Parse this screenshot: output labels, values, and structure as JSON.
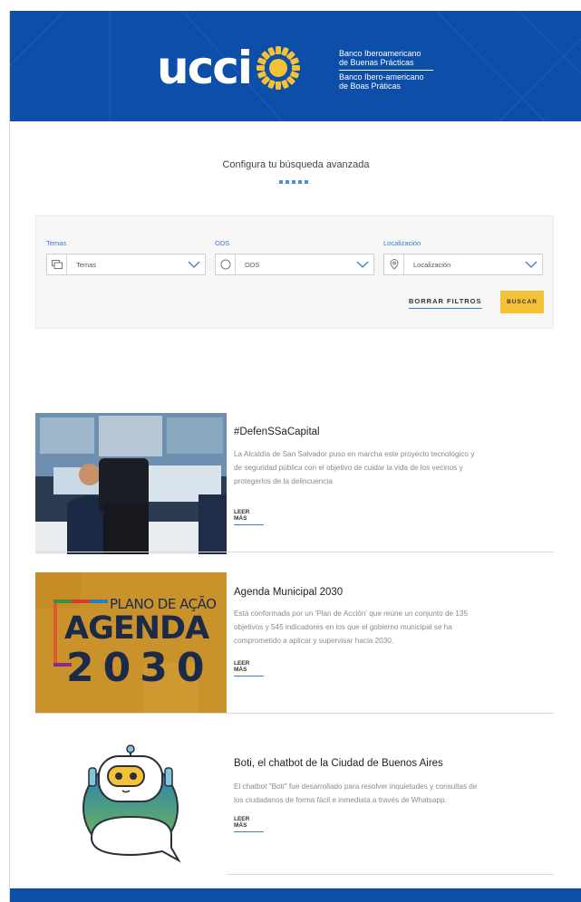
{
  "header": {
    "logo_word": "ucci",
    "tagline_es_1": "Banco Iberoamericano",
    "tagline_es_2": "de Buenas Prácticas",
    "tagline_pt_1": "Banco Ibero-americano",
    "tagline_pt_2": "de Boas Práticas",
    "bg_color": "#0d4fa8",
    "sun_color": "#f5c136"
  },
  "search": {
    "title": "Configura tu búsqueda avanzada",
    "filters": [
      {
        "label": "Temas",
        "placeholder": "Temas",
        "icon": "folders-icon"
      },
      {
        "label": "ODS",
        "placeholder": "ODS",
        "icon": "circle-icon"
      },
      {
        "label": "Localización",
        "placeholder": "Localización",
        "icon": "map-pin-icon"
      }
    ],
    "clear_label": "BORRAR FILTROS",
    "search_label": "BUSCAR",
    "accent": "#f5c136"
  },
  "articles": [
    {
      "title": "#DefenSSaCapital",
      "desc_1": "La Alcaldía de San Salvador puso en marcha este proyecto tecnológico y",
      "desc_2": "de seguridad pública con el objetivo de cuidar la vida de los vecinos y",
      "desc_3": "protegerlos de la delincuencia",
      "link": "LEER MÁS"
    },
    {
      "title": "Agenda Municipal 2030",
      "desc_1": "Está conformada por un 'Plan de Acción' que reúne un conjunto de 135",
      "desc_2": "objetivos y 545 indicadores en los que el gobierno municipal se ha",
      "desc_3": "comprometido a aplicar y supervisar hacia 2030.",
      "link": "LEER MÁS",
      "image_text_1": "PLANO DE AÇÃO",
      "image_text_2": "AGENDA",
      "image_text_3": "2030"
    },
    {
      "title": "Boti, el chatbot de la Ciudad de Buenos Aires",
      "desc_1": "El chatbot \"Boti\" fue desarrollado para resolver inquietudes y consultas de",
      "desc_2": "los ciudadanos de forma fácil e inmediata a través de Whatsapp.",
      "link": "LEER MÁS"
    }
  ]
}
